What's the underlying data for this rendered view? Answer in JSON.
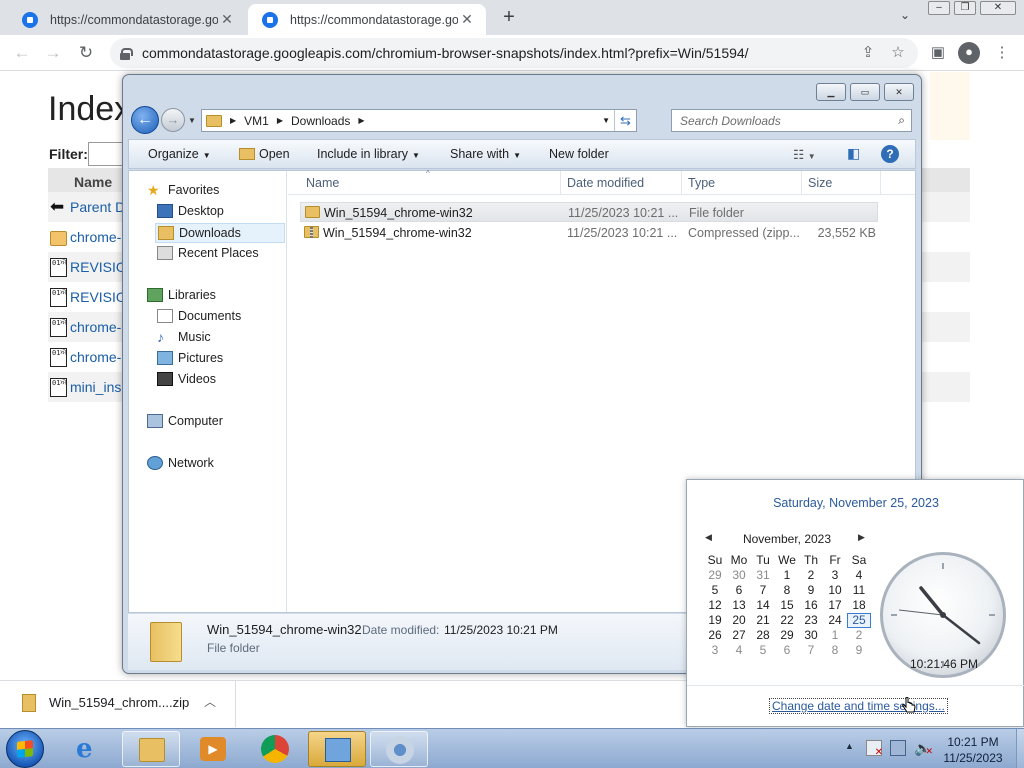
{
  "browser": {
    "tabs": [
      {
        "title": "https://commondatastorage.goo"
      },
      {
        "title": "https://commondatastorage.goo"
      }
    ],
    "address": "commondatastorage.googleapis.com/chromium-browser-snapshots/index.html?prefix=Win/51594/"
  },
  "page": {
    "title": "Index",
    "filter_label": "Filter:",
    "column_name": "Name",
    "rows": [
      {
        "label": "Parent D",
        "icon": "back-arrow-icon"
      },
      {
        "label": "chrome-",
        "icon": "folder-icon"
      },
      {
        "label": "REVISIO",
        "icon": "binary-file-icon"
      },
      {
        "label": "REVISIO",
        "icon": "binary-file-icon"
      },
      {
        "label": "chrome-",
        "icon": "binary-file-icon"
      },
      {
        "label": "chrome-",
        "icon": "binary-file-icon"
      },
      {
        "label": "mini_ins",
        "icon": "binary-file-icon"
      }
    ]
  },
  "explorer": {
    "breadcrumb": [
      "VM1",
      "Downloads"
    ],
    "search_placeholder": "Search Downloads",
    "commands": {
      "organize": "Organize",
      "open": "Open",
      "include": "Include in library",
      "share": "Share with",
      "new_folder": "New folder"
    },
    "nav": {
      "favorites": "Favorites",
      "desktop": "Desktop",
      "downloads": "Downloads",
      "recent": "Recent Places",
      "libraries": "Libraries",
      "documents": "Documents",
      "music": "Music",
      "pictures": "Pictures",
      "videos": "Videos",
      "computer": "Computer",
      "network": "Network"
    },
    "columns": {
      "name": "Name",
      "date": "Date modified",
      "type": "Type",
      "size": "Size"
    },
    "files": [
      {
        "name": "Win_51594_chrome-win32",
        "date": "11/25/2023 10:21 ...",
        "type": "File folder",
        "size": ""
      },
      {
        "name": "Win_51594_chrome-win32",
        "date": "11/25/2023 10:21 ...",
        "type": "Compressed (zipp...",
        "size": "23,552 KB"
      }
    ],
    "details": {
      "name": "Win_51594_chrome-win32",
      "date_label": "Date modified:",
      "date": "11/25/2023 10:21 PM",
      "type": "File folder"
    }
  },
  "download_shelf": {
    "item": "Win_51594_chrom....zip"
  },
  "clock": {
    "long_date": "Saturday, November 25, 2023",
    "month": "November, 2023",
    "weekdays": [
      "Su",
      "Mo",
      "Tu",
      "We",
      "Th",
      "Fr",
      "Sa"
    ],
    "weeks": [
      [
        "29",
        "30",
        "31",
        "1",
        "2",
        "3",
        "4"
      ],
      [
        "5",
        "6",
        "7",
        "8",
        "9",
        "10",
        "11"
      ],
      [
        "12",
        "13",
        "14",
        "15",
        "16",
        "17",
        "18"
      ],
      [
        "19",
        "20",
        "21",
        "22",
        "23",
        "24",
        "25"
      ],
      [
        "26",
        "27",
        "28",
        "29",
        "30",
        "1",
        "2"
      ],
      [
        "3",
        "4",
        "5",
        "6",
        "7",
        "8",
        "9"
      ]
    ],
    "time": "10:21:46 PM",
    "change_link": "Change date and time settings..."
  },
  "taskbar": {
    "time": "10:21 PM",
    "date": "11/25/2023"
  }
}
